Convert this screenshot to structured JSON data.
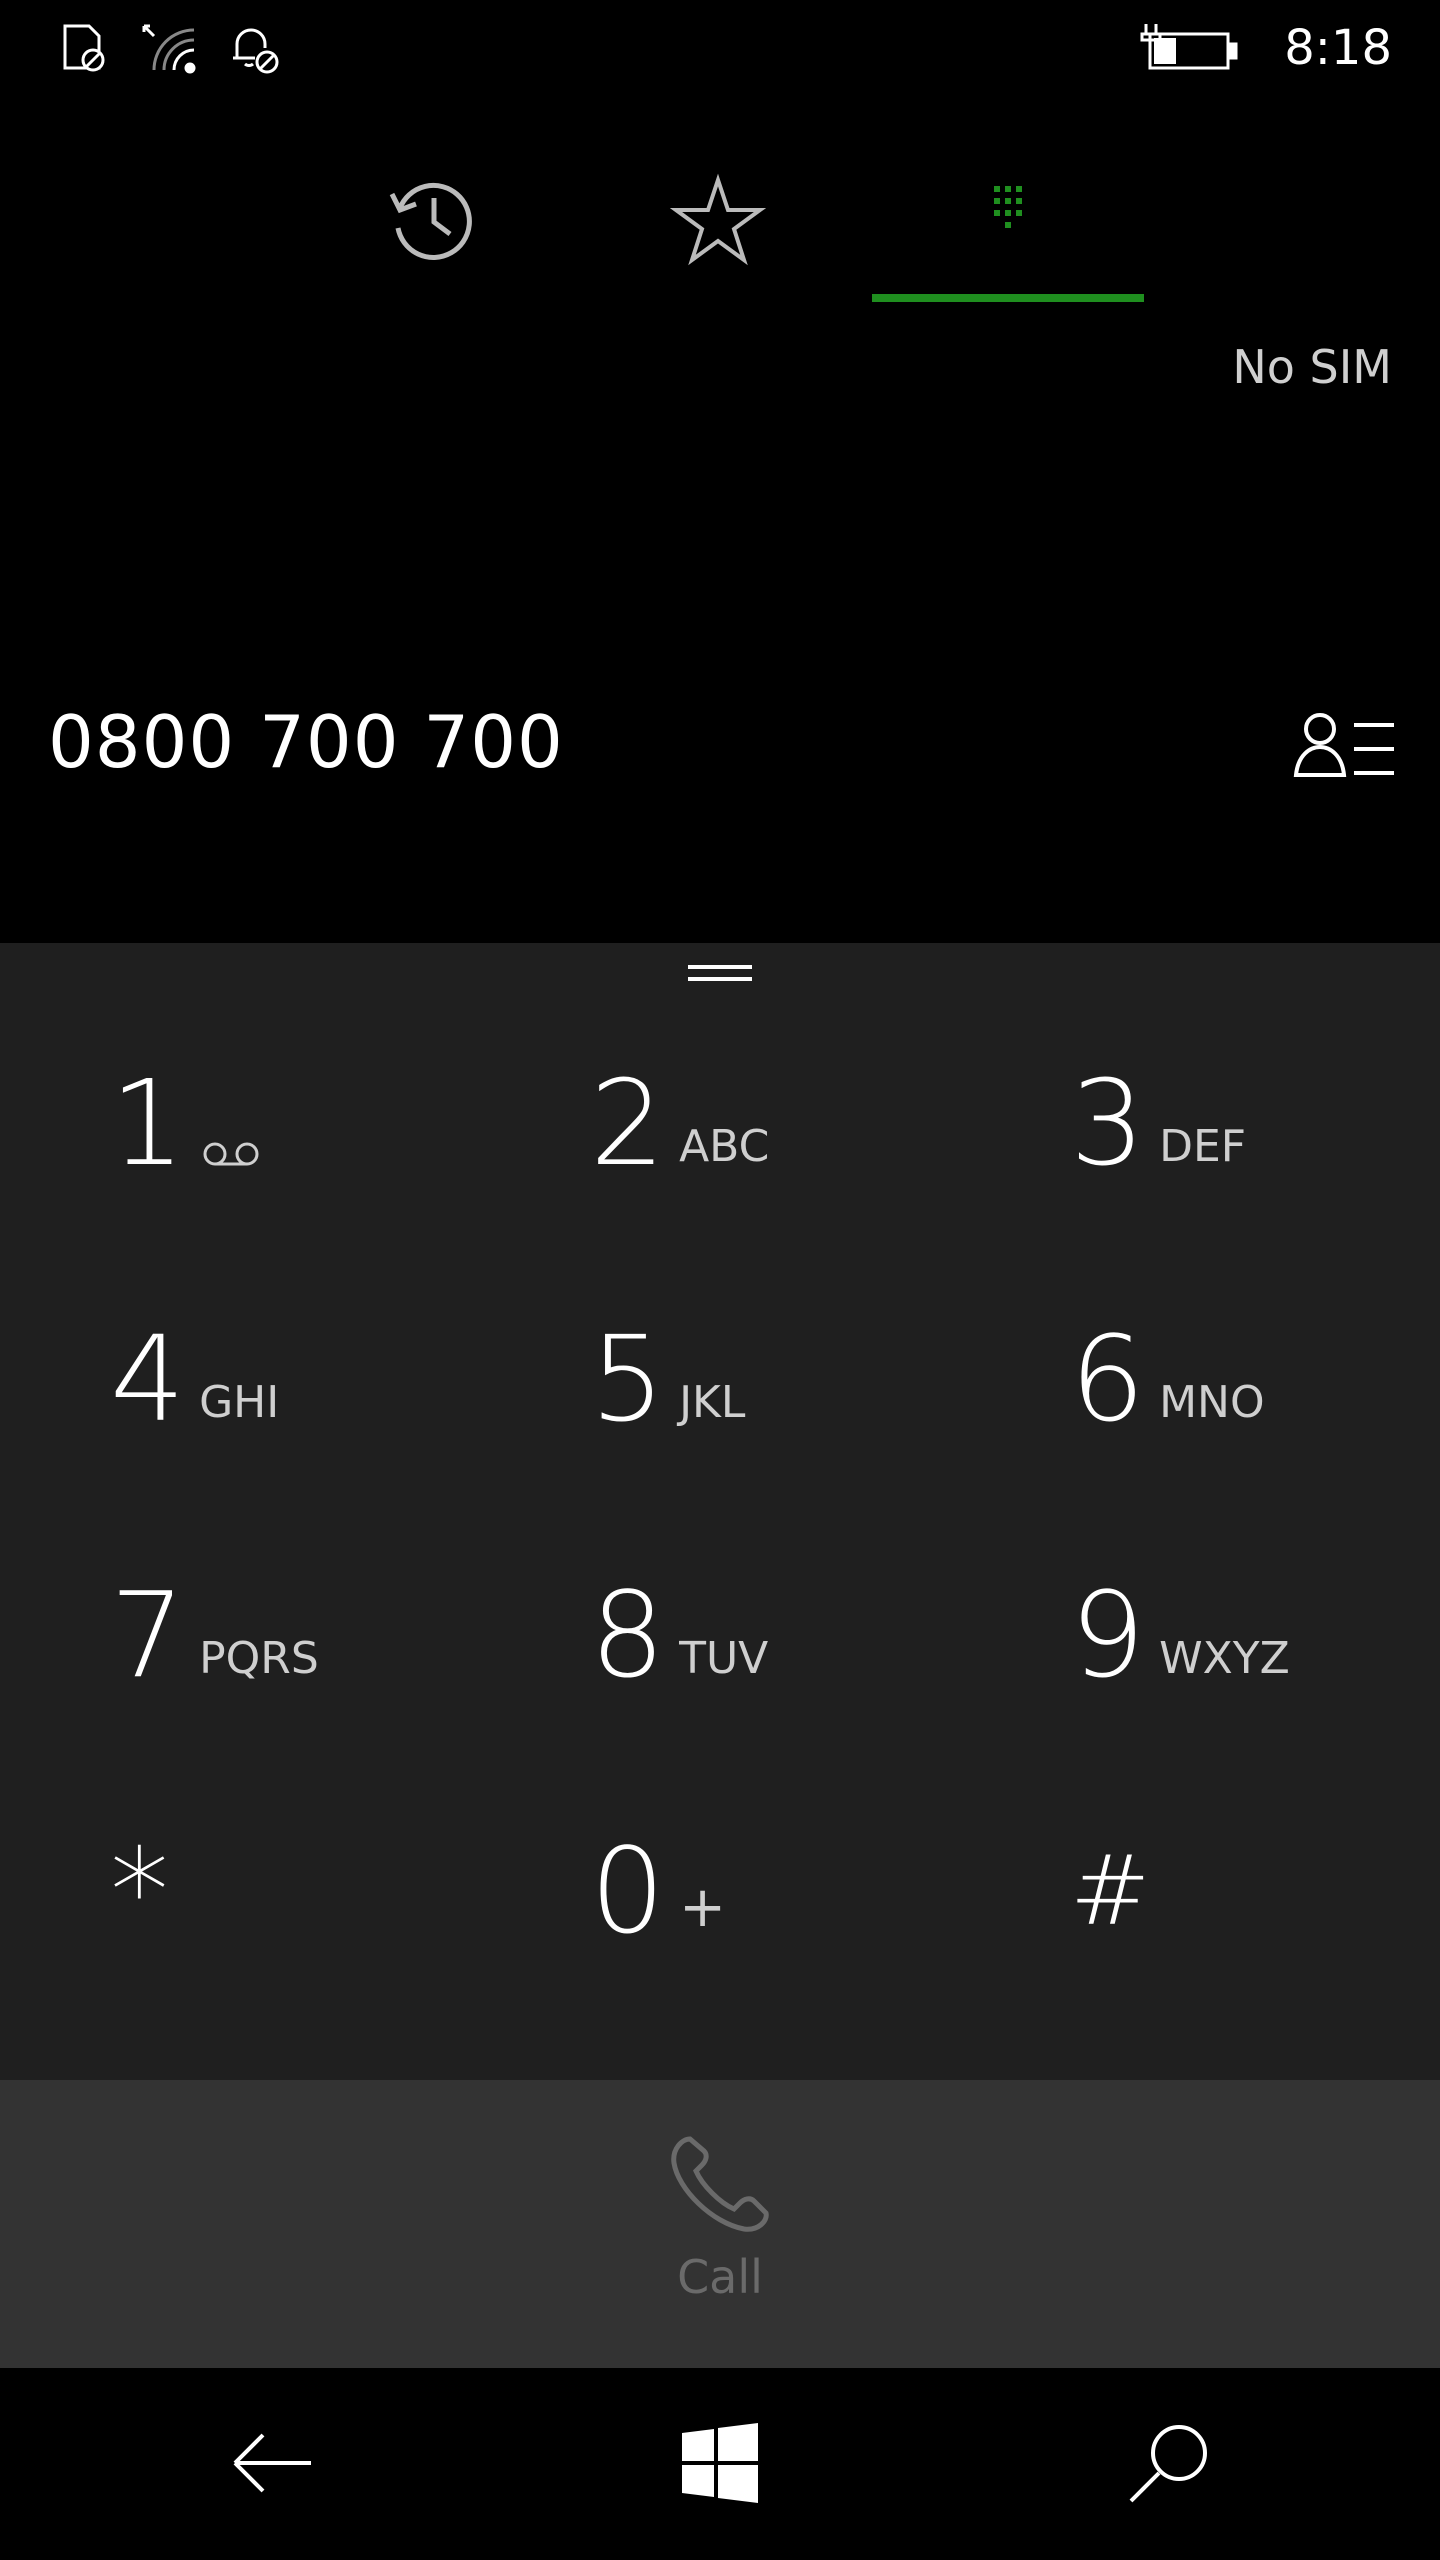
{
  "status_bar": {
    "time": "8:18",
    "icons": [
      "no-sim-icon",
      "wifi-icon",
      "quiet-hours-icon",
      "battery-charging-icon"
    ]
  },
  "tabs": [
    {
      "name": "history",
      "icon": "history-icon",
      "selected": false
    },
    {
      "name": "speed-dial",
      "icon": "star-icon",
      "selected": false
    },
    {
      "name": "keypad",
      "icon": "keypad-icon",
      "selected": true
    }
  ],
  "accent_color": "#1f8f1f",
  "sim_status": "No SIM",
  "dialed_number": "0800 700 700",
  "keys": [
    {
      "digit": "1",
      "letters": "",
      "icon": "voicemail-icon"
    },
    {
      "digit": "2",
      "letters": "ABC"
    },
    {
      "digit": "3",
      "letters": "DEF"
    },
    {
      "digit": "4",
      "letters": "GHI"
    },
    {
      "digit": "5",
      "letters": "JKL"
    },
    {
      "digit": "6",
      "letters": "MNO"
    },
    {
      "digit": "7",
      "letters": "PQRS"
    },
    {
      "digit": "8",
      "letters": "TUV"
    },
    {
      "digit": "9",
      "letters": "WXYZ"
    },
    {
      "digit": "*",
      "letters": ""
    },
    {
      "digit": "0",
      "letters": "+"
    },
    {
      "digit": "#",
      "letters": ""
    }
  ],
  "call": {
    "label": "Call"
  },
  "nav": [
    "back-icon",
    "windows-icon",
    "search-icon"
  ]
}
